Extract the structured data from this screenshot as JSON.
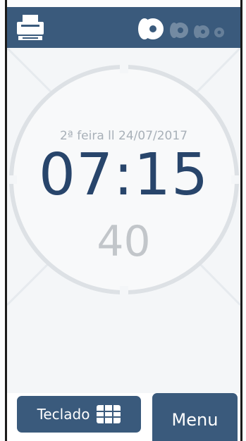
{
  "header": {
    "printer_icon": "printer-icon",
    "paper_rolls": [
      "paper-roll-icon-active",
      "paper-roll-icon-dim",
      "paper-roll-icon-dim",
      "paper-roll-icon-dim"
    ]
  },
  "clock": {
    "date": "2ª feira ll 24/07/2017",
    "time": "07:15",
    "seconds": "40"
  },
  "footer": {
    "keyboard_label": "Teclado",
    "keyboard_icon": "keypad-grid-icon",
    "menu_label": "Menu"
  },
  "colors": {
    "bar": "#3a5a7c",
    "time": "#28456b",
    "seconds": "#c2c6ca",
    "date": "#a8b0b8"
  }
}
